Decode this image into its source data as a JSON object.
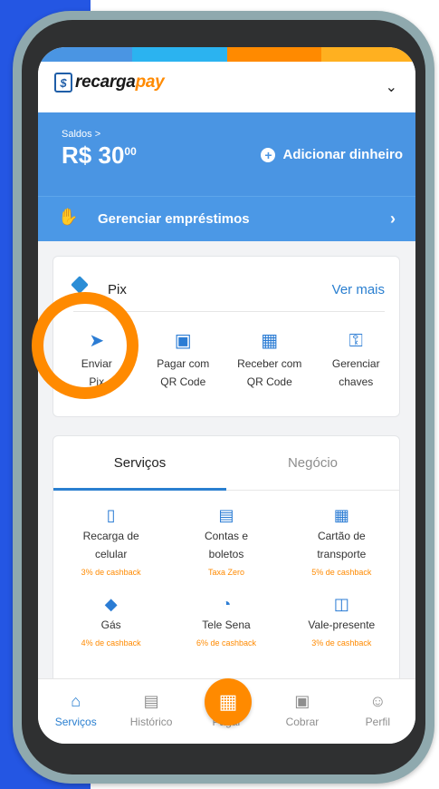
{
  "colors": {
    "brand_blue": "#4a95e3",
    "accent_orange": "#ff8a00",
    "link_blue": "#2a7fd0",
    "page_blue": "#2456e3"
  },
  "stripes": [
    "#4a95e3",
    "#2bb3f0",
    "#ff8a00",
    "#ffb020"
  ],
  "header": {
    "logo_mark": "$",
    "logo_part1": "recarga",
    "logo_part2": "pay",
    "chevron": "⌄"
  },
  "balance": {
    "label": "Saldos >",
    "currency": "R$",
    "whole": "30",
    "cents": "00",
    "add_label": "Adicionar dinheiro"
  },
  "loans": {
    "label": "Gerenciar empréstimos"
  },
  "pix": {
    "title": "Pix",
    "see_more": "Ver mais",
    "actions": [
      {
        "line1": "Enviar",
        "line2": "Pix",
        "icon": "send-icon"
      },
      {
        "line1": "Pagar com",
        "line2": "QR Code",
        "icon": "scan-qr-icon"
      },
      {
        "line1": "Receber com",
        "line2": "QR Code",
        "icon": "qr-code-icon"
      },
      {
        "line1": "Gerenciar",
        "line2": "chaves",
        "icon": "key-icon"
      }
    ]
  },
  "services": {
    "tabs": [
      "Serviços",
      "Negócio"
    ],
    "items": [
      {
        "line1": "Recarga de",
        "line2": "celular",
        "cashback": "3% de cashback",
        "icon": "phone-icon"
      },
      {
        "line1": "Contas e",
        "line2": "boletos",
        "cashback": "Taxa Zero",
        "icon": "bill-icon"
      },
      {
        "line1": "Cartão de",
        "line2": "transporte",
        "cashback": "5% de cashback",
        "icon": "bus-icon"
      },
      {
        "line1": "Gás",
        "line2": "",
        "cashback": "4% de cashback",
        "icon": "gas-icon"
      },
      {
        "line1": "Tele Sena",
        "line2": "",
        "cashback": "6% de cashback",
        "icon": "tele-sena-icon"
      },
      {
        "line1": "Vale-presente",
        "line2": "",
        "cashback": "3% de cashback",
        "icon": "gift-icon"
      }
    ]
  },
  "nav": [
    {
      "label": "Serviços",
      "icon": "home-icon"
    },
    {
      "label": "Histórico",
      "icon": "history-icon"
    },
    {
      "label": "Pagar",
      "icon": "qr-pay-icon"
    },
    {
      "label": "Cobrar",
      "icon": "charge-icon"
    },
    {
      "label": "Perfil",
      "icon": "profile-icon"
    }
  ]
}
